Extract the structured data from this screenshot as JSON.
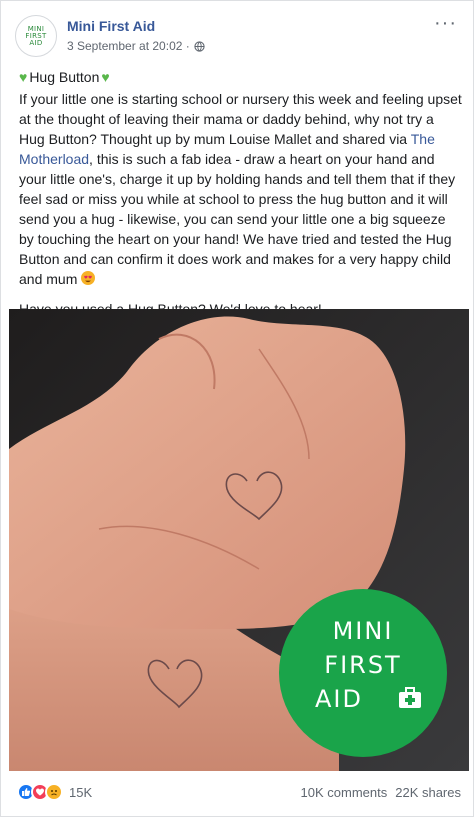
{
  "post": {
    "author": "Mini First Aid",
    "timestamp": "3 September at 20:02 ·",
    "avatar_text": [
      "MINI",
      "FIRST",
      "AID"
    ],
    "more_label": "···",
    "title": "Hug Button",
    "title_emoji": "green-heart-icon",
    "body_part1": "If your little one is starting school or nursery this week and feeling upset at the thought of leaving their mama or daddy behind, why not try a Hug Button? Thought up by mum Louise Mallet and shared via ",
    "body_link": "The Motherload",
    "body_part2": ", this is such a fab idea - draw a heart on your hand and your little one's, charge it up by holding hands and tell them that if they feel sad or miss you while at school to press the hug button and it will send you a hug - likewise, you can send your little one a big squeeze by touching the heart on your hand! We have tried and tested the Hug Button and can confirm it does work and makes for a very happy child and mum ",
    "body_emoji": "heart-eyes-emoji-icon",
    "question": "Have you used a Hug Button? We'd love to hear!"
  },
  "photo": {
    "badge_lines": [
      "MINI",
      "FIRST",
      "AID"
    ],
    "badge_color": "#1aa44a"
  },
  "footer": {
    "reaction_count": "15K",
    "comments": "10K comments",
    "shares": "22K shares"
  },
  "colors": {
    "link": "#385898",
    "text": "#1c1e21",
    "meta": "#606770"
  }
}
